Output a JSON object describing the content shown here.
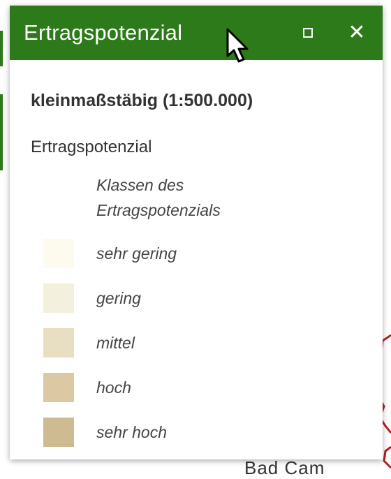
{
  "window": {
    "title": "Ertragspotenzial",
    "maximize_icon": "maximize-icon",
    "close_icon": "close-icon",
    "close_symbol": "✕"
  },
  "legend": {
    "scale_heading": "kleinmaßstäbig (1:500.000)",
    "layer_name": "Ertragspotenzial",
    "class_title": "Klassen des Ertragspotenzials",
    "classes": [
      {
        "label": "sehr gering",
        "color": "#fdfbee"
      },
      {
        "label": "gering",
        "color": "#f3f0dd"
      },
      {
        "label": "mittel",
        "color": "#e8dfc3"
      },
      {
        "label": "hoch",
        "color": "#dcc8a2"
      },
      {
        "label": "sehr hoch",
        "color": "#cfbb91"
      }
    ]
  },
  "colors": {
    "titlebar": "#2d7a1a",
    "map_feature": "#b22222"
  },
  "map": {
    "partial_label": "Bad Cam"
  }
}
